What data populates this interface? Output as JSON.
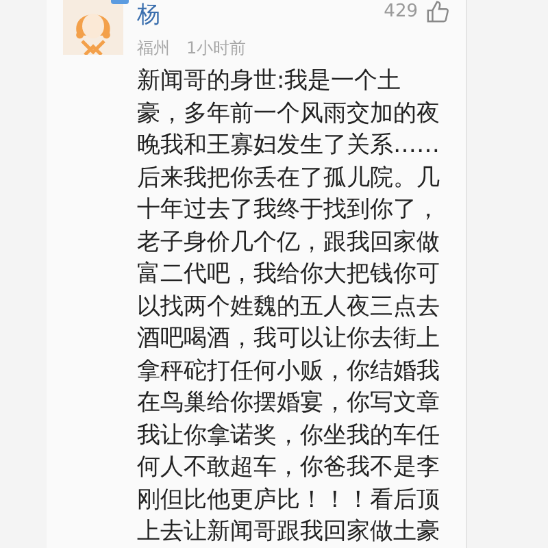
{
  "comment": {
    "author": "杨",
    "location": "福州",
    "time": "1小时前",
    "likes": "429",
    "text": "新闻哥的身世:我是一个土豪，多年前一个风雨交加的夜晚我和王寡妇发生了关系……后来我把你丢在了孤儿院。几十年过去了我终于找到你了，老子身价几个亿，跟我回家做富二代吧，我给你大把钱你可以找两个姓魏的五人夜三点去酒吧喝酒，我可以让你去街上拿秤砣打任何小贩，你结婚我在鸟巢给你摆婚宴，你写文章我让你拿诺奖，你坐我的车任何人不敢超车，你爸我不是李刚但比他更庐比！！！看后顶上去让新闻哥跟我回家做土豪"
  }
}
